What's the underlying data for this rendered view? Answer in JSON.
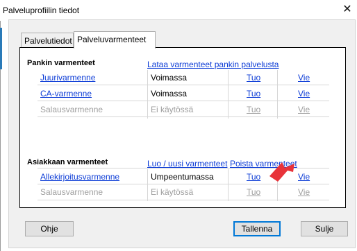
{
  "window": {
    "title": "Palveluprofiilin tiedot",
    "close_glyph": "✕"
  },
  "tabs": [
    {
      "label": "Palvelutiedot"
    },
    {
      "label": "Palveluvarmenteet"
    }
  ],
  "bank_section": {
    "heading": "Pankin varmenteet",
    "action_link": "Lataa varmenteet pankin palvelusta",
    "rows": [
      {
        "name": "Juurivarmenne",
        "status": "Voimassa",
        "import": "Tuo",
        "export": "Vie",
        "enabled": true
      },
      {
        "name": "CA-varmenne",
        "status": "Voimassa",
        "import": "Tuo",
        "export": "Vie",
        "enabled": true
      },
      {
        "name": "Salausvarmenne",
        "status": "Ei käytössä",
        "import": "Tuo",
        "export": "Vie",
        "enabled": false
      }
    ]
  },
  "customer_section": {
    "heading": "Asiakkaan varmenteet",
    "create_link": "Luo / uusi varmenteet",
    "remove_link": "Poista varmenteet",
    "rows": [
      {
        "name": "Allekirjoitusvarmenne",
        "status": "Umpeentumassa",
        "import": "Tuo",
        "export": "Vie",
        "enabled": true
      },
      {
        "name": "Salausvarmenne",
        "status": "Ei käytössä",
        "import": "Tuo",
        "export": "Vie",
        "enabled": false
      }
    ]
  },
  "buttons": {
    "help": "Ohje",
    "save": "Tallenna",
    "close": "Sulje"
  },
  "colors": {
    "link": "#0b3bd6",
    "disabled": "#9e9e9e",
    "annotation_arrow": "#e8333a"
  }
}
